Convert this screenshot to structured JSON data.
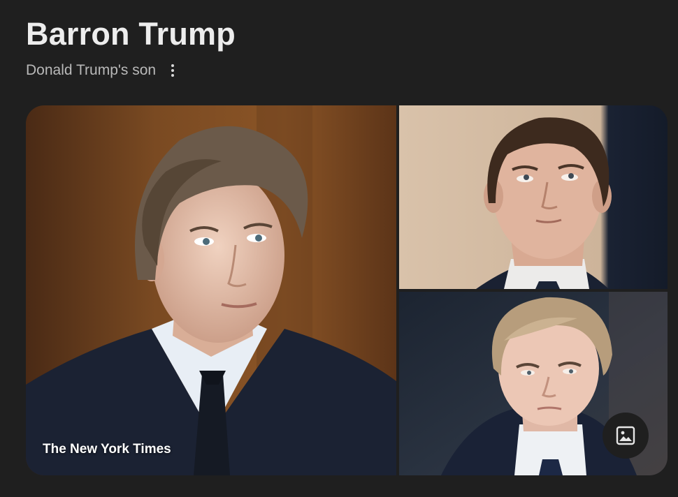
{
  "entity": {
    "title": "Barron Trump",
    "subtitle": "Donald Trump's son"
  },
  "gallery": {
    "images": [
      {
        "alt": "Barron Trump",
        "source": "The New York Times"
      },
      {
        "alt": "Barron Trump"
      },
      {
        "alt": "Barron Trump"
      }
    ]
  },
  "icons": {
    "more": "more-vert-icon",
    "images": "image-icon"
  },
  "colors": {
    "background": "#1f1f1f",
    "title": "#ededed",
    "subtitle": "#b9b9b9"
  }
}
